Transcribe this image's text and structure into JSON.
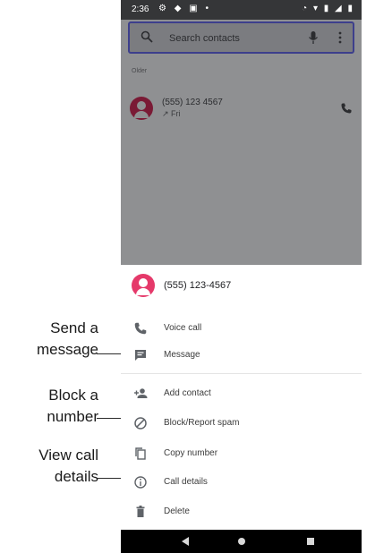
{
  "callouts": {
    "send_message": [
      "Send a",
      "message"
    ],
    "block_number": [
      "Block a",
      "number"
    ],
    "call_details": [
      "View call",
      "details"
    ]
  },
  "status_bar": {
    "time": "2:36"
  },
  "search": {
    "placeholder": "Search contacts"
  },
  "section_label": "Older",
  "recent_call": {
    "number": "(555) 123 4567",
    "detail": "↗ Fri"
  },
  "sheet": {
    "number": "(555) 123-4567",
    "actions": [
      {
        "label": "Voice call",
        "icon": "phone-icon"
      },
      {
        "label": "Message",
        "icon": "message-icon"
      },
      {
        "label": "Add contact",
        "icon": "add-contact-icon"
      },
      {
        "label": "Block/Report spam",
        "icon": "block-icon"
      },
      {
        "label": "Copy number",
        "icon": "copy-icon"
      },
      {
        "label": "Call details",
        "icon": "info-icon"
      },
      {
        "label": "Delete",
        "icon": "trash-icon"
      }
    ]
  },
  "colors": {
    "avatar_accent": "#e5396a",
    "scrim": "#8f9092",
    "search_border": "#3d3f8c"
  }
}
